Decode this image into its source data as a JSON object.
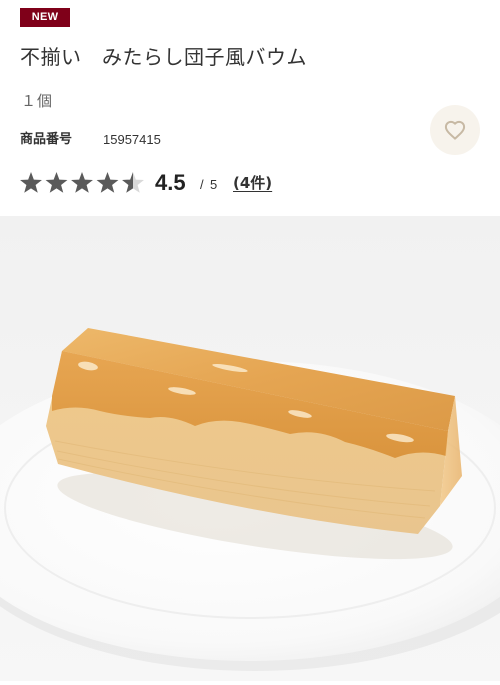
{
  "badge": {
    "label": "NEW",
    "color": "#7f0019"
  },
  "product": {
    "title": "不揃い　みたらし団子風バウム",
    "quantity": "１個",
    "number_label": "商品番号",
    "number_value": "15957415"
  },
  "rating": {
    "value": "4.5",
    "slash": "/",
    "max": "5",
    "score": 4.5,
    "star_color": "#5a5a5a",
    "star_empty_color": "#d9d9d9",
    "reviews_label": "(4件)"
  },
  "favorite": {
    "icon": "heart-icon",
    "bg_color": "#f7f3ec",
    "icon_color": "#c7b9a4"
  },
  "image": {
    "description_icon": "product-photo"
  }
}
